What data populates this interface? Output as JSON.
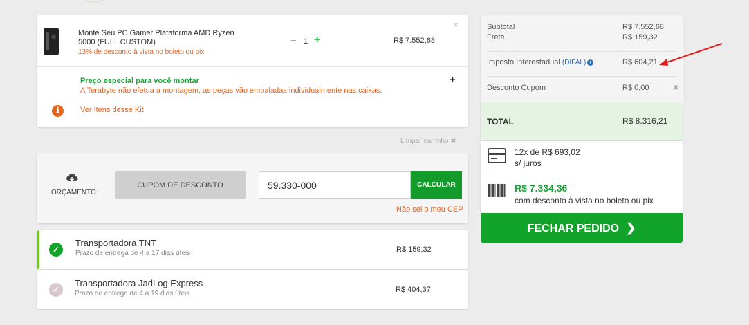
{
  "product": {
    "name": "Monte Seu PC Gamer Plataforma AMD Ryzen 5000 (FULL CUSTOM)",
    "discount_note": "13% de desconto à vista no boleto ou pix",
    "quantity": "1",
    "qty_minus": "−",
    "qty_plus": "+",
    "price": "R$ 7.552,68",
    "remove": "×",
    "assembly_title": "Preço especial para você montar",
    "assembly_note": "A Terabyte não efetua a montagem, as peças vão embaladas individualmente nas caixas.",
    "assembly_toggle": "+",
    "kit_link": "Ver Itens desse Kit",
    "info_icon": "ℹ"
  },
  "cart": {
    "clear_label": "Limpar carrinho",
    "clear_icon": "✖"
  },
  "coupon": {
    "budget_label": "ORÇAMENTO",
    "coupon_button": "CUPOM DE DESCONTO",
    "cep_value": "59.330-000",
    "calc_button": "CALCULAR",
    "cep_link": "Não sei o meu CEP"
  },
  "shipping": [
    {
      "name": "Transportadora TNT",
      "time": "Prazo de entrega de 4 a 17 dias úteis",
      "price": "R$ 159,32",
      "selected": true,
      "check": "✓"
    },
    {
      "name": "Transportadora JadLog Express",
      "time": "Prazo de entrega de 4 a 19 dias úteis",
      "price": "R$ 404,37",
      "selected": false,
      "check": "✓"
    }
  ],
  "summary": {
    "subtotal_label": "Subtotal",
    "subtotal_value": "R$ 7.552,68",
    "freight_label": "Frete",
    "freight_value": "R$ 159,32",
    "tax_label": "Imposto Interestadual",
    "tax_link": "(DIFAL)",
    "tax_info": "i",
    "tax_value": "R$ 604,21",
    "coupon_label": "Desconto Cupom",
    "coupon_value": "R$ 0,00",
    "coupon_remove": "✖",
    "total_label": "TOTAL",
    "total_value": "R$ 8.316,21"
  },
  "payment": {
    "installments": "12x de R$ 693,02",
    "no_interest": "s/ juros",
    "boleto_price": "R$ 7.334,36",
    "boleto_note": "com desconto à vista no boleto ou pix"
  },
  "checkout": {
    "label": "FECHAR PEDIDO",
    "chevron": "❯"
  },
  "colors": {
    "green": "#12a42a",
    "orange": "#e56520",
    "link_blue": "#2d6fba",
    "annotation_red": "#e21b1b",
    "selected_border": "#6fc52c",
    "unselected_check": "#d9c7cc"
  }
}
